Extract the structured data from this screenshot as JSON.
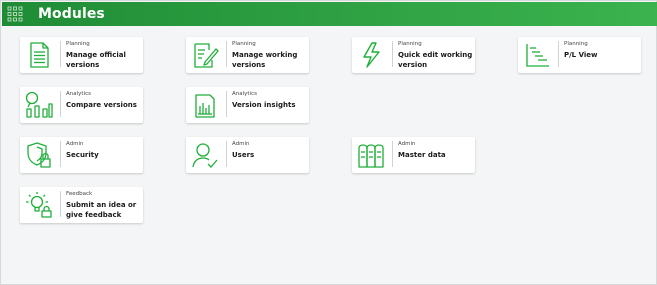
{
  "header": {
    "title": "Modules",
    "color": "#2ea043"
  },
  "accent_color": "#1fae3a",
  "tiles": [
    {
      "category": "Planning",
      "name": "Manage official versions",
      "icon": "document-icon"
    },
    {
      "category": "Planning",
      "name": "Manage working versions",
      "icon": "edit-document-icon"
    },
    {
      "category": "Planning",
      "name": "Quick edit working version",
      "icon": "lightning-icon"
    },
    {
      "category": "Planning",
      "name": "P/L View",
      "icon": "stepped-list-icon"
    },
    {
      "category": "Analytics",
      "name": "Compare versions",
      "icon": "magnifier-chart-icon"
    },
    {
      "category": "Analytics",
      "name": "Version insights",
      "icon": "chart-report-icon"
    },
    {
      "category": "Admin",
      "name": "Security",
      "icon": "shield-lock-icon"
    },
    {
      "category": "Admin",
      "name": "Users",
      "icon": "user-check-icon"
    },
    {
      "category": "Admin",
      "name": "Master data",
      "icon": "binders-icon"
    },
    {
      "category": "Feedback",
      "name": "Submit an idea or give feedback",
      "icon": "idea-bulb-icon"
    }
  ]
}
